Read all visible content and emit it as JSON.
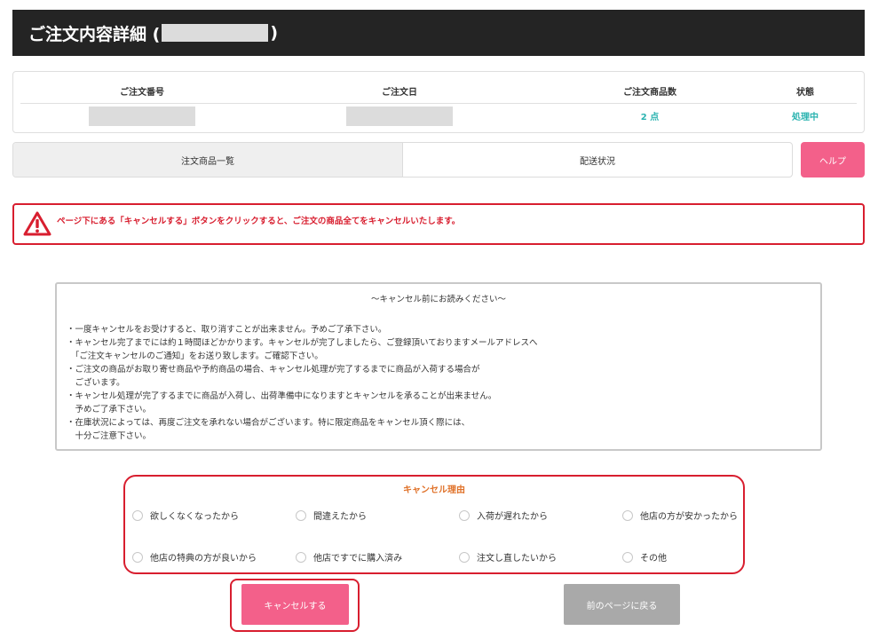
{
  "header": {
    "title_prefix": "ご注文内容詳細 (",
    "title_suffix": ")"
  },
  "summary": {
    "order_number_label": "ご注文番号",
    "order_date_label": "ご注文日",
    "item_count_label": "ご注文商品数",
    "item_count_value": "2 点",
    "status_label": "状態",
    "status_value": "処理中"
  },
  "tabs": [
    {
      "label": "注文商品一覧"
    },
    {
      "label": "配送状況"
    }
  ],
  "help_button": "ヘルプ",
  "warning": {
    "text": "ページ下にある「キャンセルする」ボタンをクリックすると、ご注文の商品全てをキャンセルいたします。",
    "icon_color": "#d81e2f"
  },
  "notice": {
    "title": "〜キャンセル前にお読みください〜",
    "lines": [
      "・一度キャンセルをお受けすると、取り消すことが出来ません。予めご了承下さい。",
      "・キャンセル完了までには約１時間ほどかかります。キャンセルが完了しましたら、ご登録頂いておりますメールアドレスへ",
      "　「ご注文キャンセルのご通知」をお送り致します。ご確認下さい。",
      "・ご注文の商品がお取り寄せ商品や予約商品の場合、キャンセル処理が完了するまでに商品が入荷する場合が",
      "　ございます。",
      "・キャンセル処理が完了するまでに商品が入荷し、出荷準備中になりますとキャンセルを承ることが出来ません。",
      "　予めご了承下さい。",
      "・在庫状況によっては、再度ご注文を承れない場合がございます。特に限定商品をキャンセル頂く際には、",
      "　十分ご注意下さい。"
    ]
  },
  "reasons": {
    "title": "キャンセル理由",
    "options": [
      "欲しくなくなったから",
      "間違えたから",
      "入荷が遅れたから",
      "他店の方が安かったから",
      "他店の特典の方が良いから",
      "他店ですでに購入済み",
      "注文し直したいから",
      "その他"
    ]
  },
  "buttons": {
    "cancel": "キャンセルする",
    "back": "前のページに戻る"
  },
  "colors": {
    "accent_pink": "#f3608a",
    "alert_red": "#d81e2f",
    "teal": "#2bb3b0",
    "orange": "#e0722a"
  }
}
